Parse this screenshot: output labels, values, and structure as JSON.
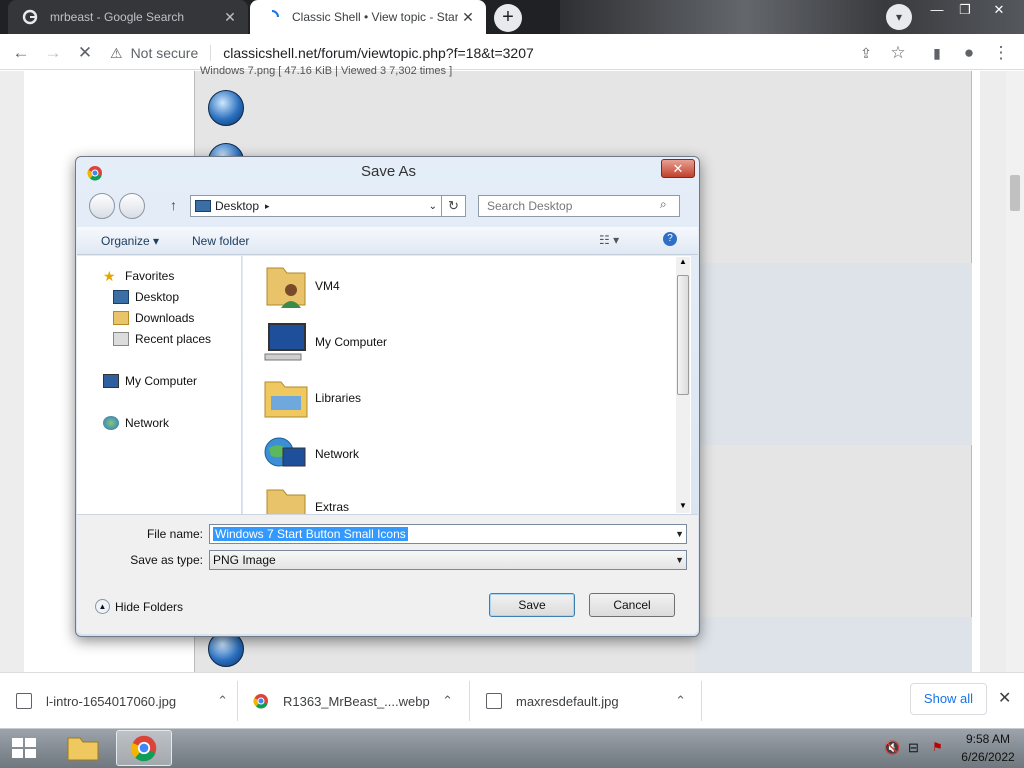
{
  "browser": {
    "tabs": [
      {
        "title": "mrbeast - Google Search",
        "active": false,
        "favicon": "google-icon"
      },
      {
        "title": "Classic Shell • View topic - Start B",
        "active": true,
        "favicon": "loading-spinner-icon"
      }
    ],
    "address": {
      "security_label": "Not secure",
      "url": "classicshell.net/forum/viewtopic.php?f=18&t=3207"
    }
  },
  "page": {
    "caption": "Windows 7.png [ 47.16 KiB | Viewed 3 7,302 times ]"
  },
  "dialog": {
    "title": "Save As",
    "breadcrumb": "Desktop",
    "search_placeholder": "Search Desktop",
    "organize_label": "Organize ▾",
    "new_folder_label": "New folder",
    "nav": {
      "favorites": "Favorites",
      "favorites_items": [
        "Desktop",
        "Downloads",
        "Recent places"
      ],
      "my_computer": "My Computer",
      "network": "Network"
    },
    "files": [
      "VM4",
      "My Computer",
      "Libraries",
      "Network",
      "Extras"
    ],
    "file_name_label": "File name:",
    "file_name_value": "Windows 7 Start Button Small Icons",
    "save_as_type_label": "Save as type:",
    "save_as_type_value": "PNG Image",
    "hide_folders_label": "Hide Folders",
    "save_label": "Save",
    "cancel_label": "Cancel"
  },
  "downloads": {
    "items": [
      "l-intro-1654017060.jpg",
      "R1363_MrBeast_....webp",
      "maxresdefault.jpg"
    ],
    "show_all_label": "Show all"
  },
  "taskbar": {
    "time": "9:58 AM",
    "date": "6/26/2022"
  },
  "colors": {
    "selection": "#3399ff",
    "link": "#1a73e8",
    "chrome_dark": "#202124"
  }
}
